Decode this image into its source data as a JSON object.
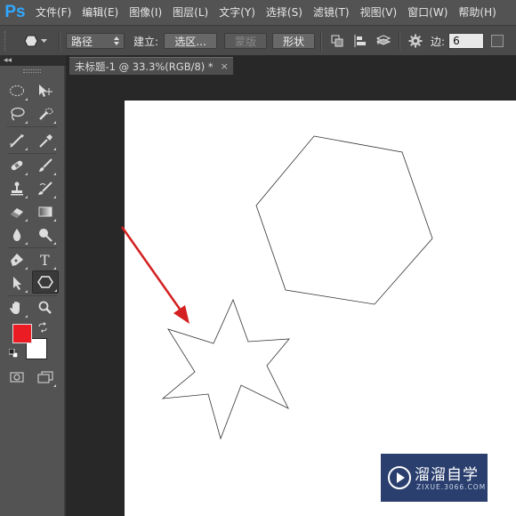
{
  "app": {
    "logo": "Ps",
    "accent": "#31a8ff"
  },
  "menu": [
    "文件(F)",
    "编辑(E)",
    "图像(I)",
    "图层(L)",
    "文字(Y)",
    "选择(S)",
    "滤镜(T)",
    "视图(V)",
    "窗口(W)",
    "帮助(H)"
  ],
  "options": {
    "mode_value": "路径",
    "make_label": "建立:",
    "selection_btn": "选区...",
    "mask_btn": "蒙版",
    "shape_btn": "形状",
    "sides_label": "边:",
    "sides_value": "6"
  },
  "document": {
    "tab_title": "未标题-1 @ 33.3%(RGB/8) *",
    "close_glyph": "×"
  },
  "colors": {
    "foreground": "#ec1c24",
    "background": "#ffffff",
    "arrow": "#d42020"
  },
  "tools": [
    "marquee-tool",
    "move-tool",
    "lasso-tool",
    "quick-selection-tool",
    "crop-tool",
    "eyedropper-tool",
    "spot-healing-tool",
    "brush-tool",
    "clone-stamp-tool",
    "history-brush-tool",
    "eraser-tool",
    "gradient-tool",
    "blur-tool",
    "dodge-tool",
    "pen-tool",
    "type-tool",
    "path-selection-tool",
    "polygon-tool",
    "hand-tool",
    "zoom-tool"
  ],
  "watermark": {
    "text": "溜溜自学",
    "url": "ZIXUE.3066.COM"
  }
}
